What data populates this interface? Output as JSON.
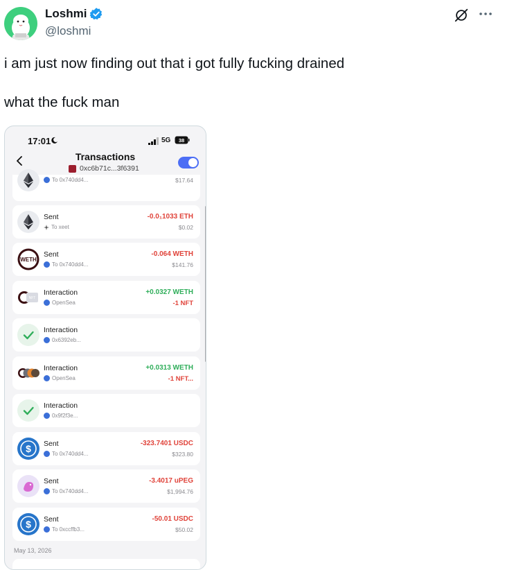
{
  "tweet": {
    "author_name": "Loshmi",
    "author_handle": "@loshmi",
    "text": "i am just now finding out that i got fully fucking drained\n\nwhat the fuck man"
  },
  "colors": {
    "verified": "#1d9bf0",
    "negative": "#e0433a",
    "positive": "#2fae5a",
    "toggle": "#4c6ef5",
    "avatar_bg": "#3ecf7e"
  },
  "phone": {
    "status": {
      "time": "17:01",
      "network": "5G",
      "battery": "38"
    },
    "header": {
      "title": "Transactions",
      "address": "0xc6b71c...3f6391"
    },
    "transactions": [
      {
        "icon": "eth-icon",
        "title": "",
        "sub_icon": "dot",
        "sub": "To 0x740dd4...",
        "amount": "",
        "amount_kind": "neg",
        "usd": "$17.64",
        "nft": ""
      },
      {
        "icon": "eth-icon",
        "title": "Sent",
        "sub_icon": "star",
        "sub": "To xeet",
        "amount": "-0.0₁1033 ETH",
        "amount_kind": "neg",
        "usd": "$0.02",
        "nft": ""
      },
      {
        "icon": "weth-icon",
        "title": "Sent",
        "sub_icon": "dot",
        "sub": "To 0x740dd4...",
        "amount": "-0.064 WETH",
        "amount_kind": "neg",
        "usd": "$141.76",
        "nft": ""
      },
      {
        "icon": "weth-nft-icon",
        "title": "Interaction",
        "sub_icon": "dot",
        "sub": "OpenSea",
        "amount": "+0.0327 WETH",
        "amount_kind": "pos",
        "usd": "",
        "nft": "-1 NFT"
      },
      {
        "icon": "check-icon",
        "title": "Interaction",
        "sub_icon": "dot",
        "sub": "0x6392eb...",
        "amount": "",
        "amount_kind": "pos",
        "usd": "",
        "nft": ""
      },
      {
        "icon": "weth-nft-multi-icon",
        "title": "Interaction",
        "sub_icon": "dot",
        "sub": "OpenSea",
        "amount": "+0.0313 WETH",
        "amount_kind": "pos",
        "usd": "",
        "nft": "-1 NFT..."
      },
      {
        "icon": "check-icon",
        "title": "Interaction",
        "sub_icon": "dot",
        "sub": "0x9f2f3e...",
        "amount": "",
        "amount_kind": "pos",
        "usd": "",
        "nft": ""
      },
      {
        "icon": "usdc-icon",
        "title": "Sent",
        "sub_icon": "dot",
        "sub": "To 0x740dd4...",
        "amount": "-323.7401 USDC",
        "amount_kind": "neg",
        "usd": "$323.80",
        "nft": ""
      },
      {
        "icon": "upeg-icon",
        "title": "Sent",
        "sub_icon": "dot",
        "sub": "To 0x740dd4...",
        "amount": "-3.4017 uPEG",
        "amount_kind": "neg",
        "usd": "$1,994.76",
        "nft": ""
      },
      {
        "icon": "usdc-icon",
        "title": "Sent",
        "sub_icon": "dot",
        "sub": "To 0xccffb3...",
        "amount": "-50.01 USDC",
        "amount_kind": "neg",
        "usd": "$50.02",
        "nft": ""
      }
    ],
    "date_label": "May 13, 2026"
  }
}
